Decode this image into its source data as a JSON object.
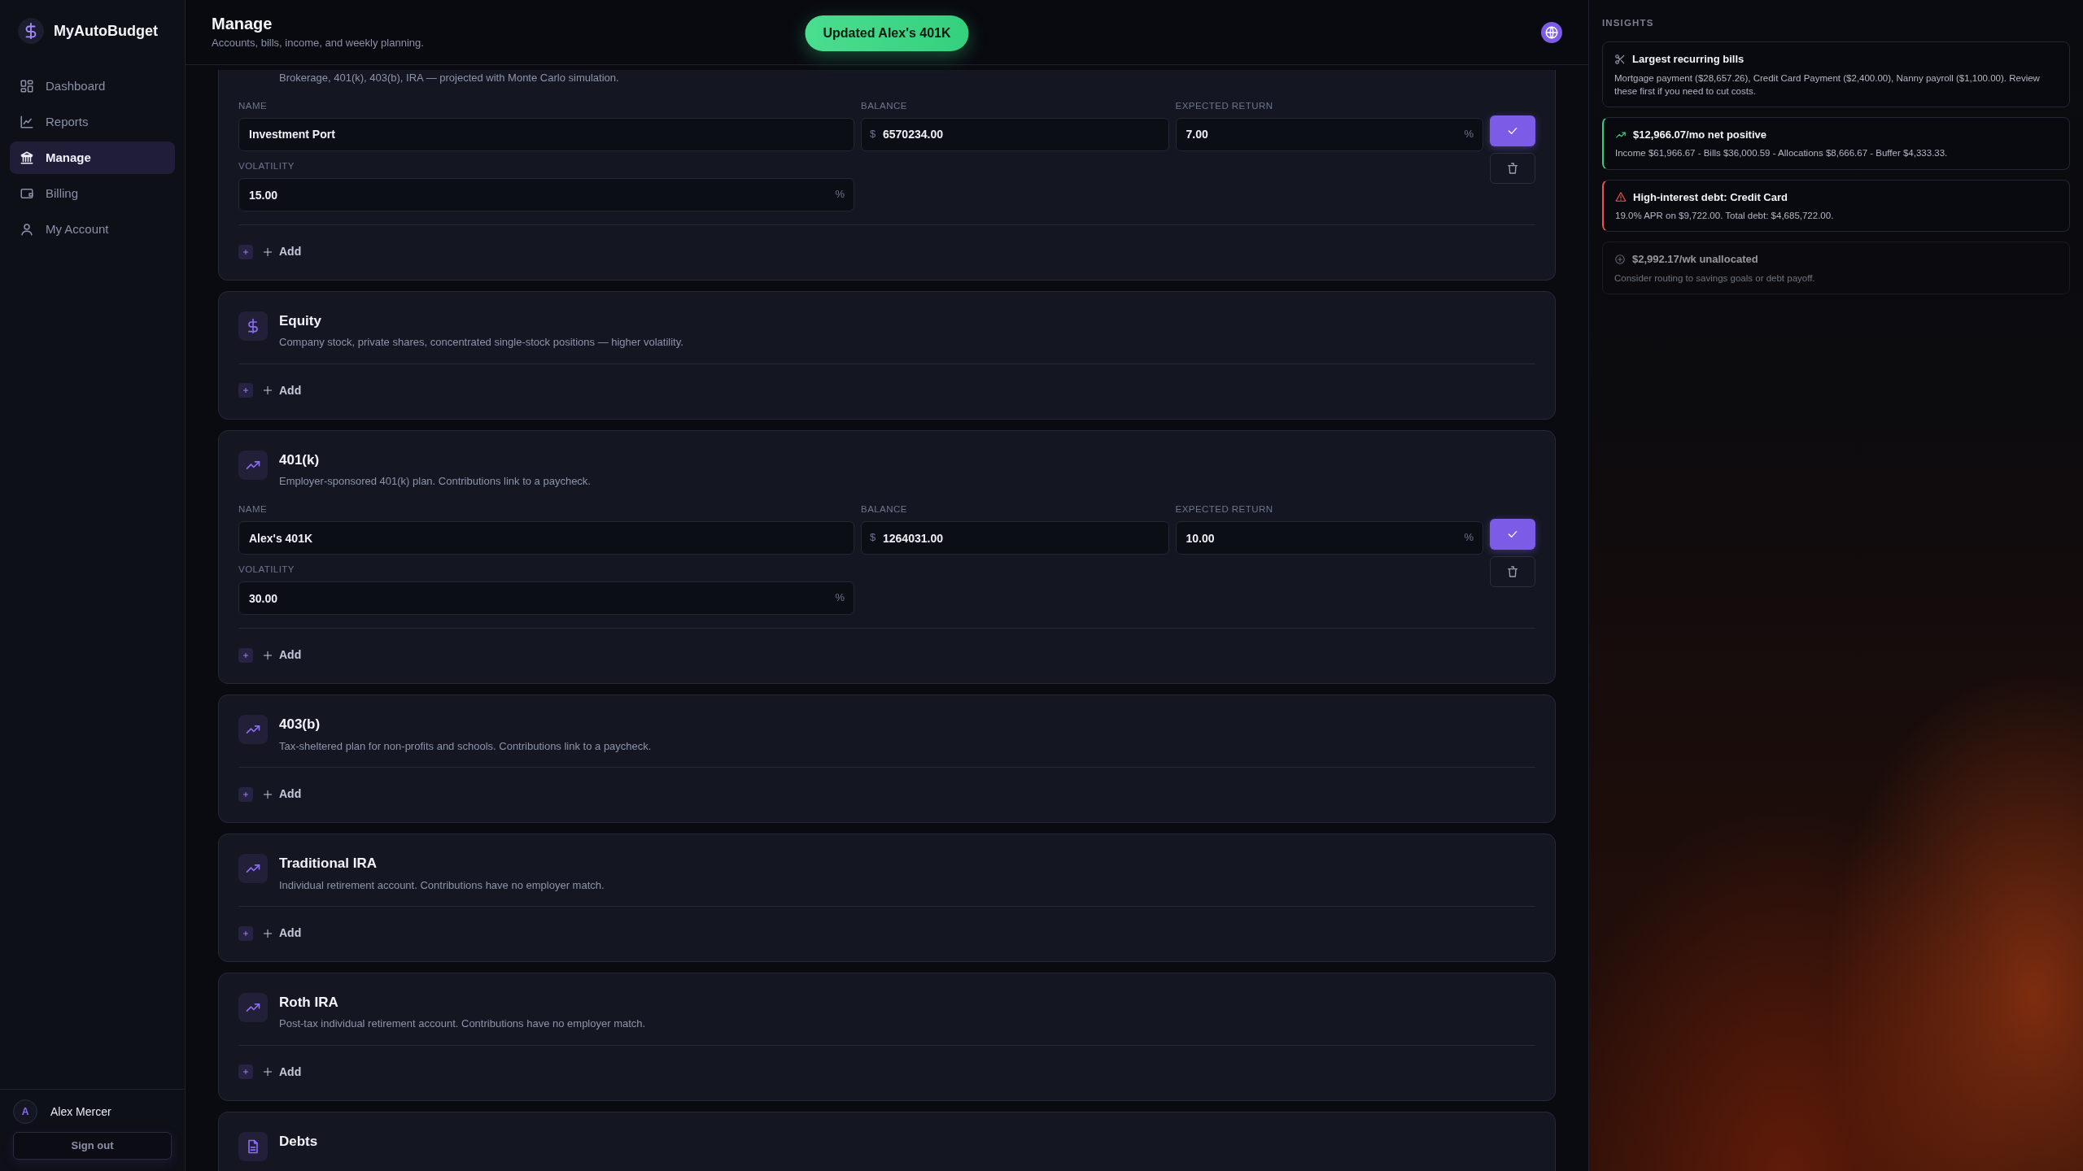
{
  "sidebar": {
    "brand": "MyAutoBudget",
    "items": [
      {
        "label": "Dashboard",
        "kind": "grid",
        "selected": false
      },
      {
        "label": "Reports",
        "kind": "chart",
        "selected": false
      },
      {
        "label": "Manage",
        "kind": "bank",
        "selected": true
      },
      {
        "label": "Billing",
        "kind": "wallet",
        "selected": false
      },
      {
        "label": "My Account",
        "kind": "user",
        "selected": false
      }
    ],
    "user": {
      "initial": "A",
      "name": "Alex Mercer"
    },
    "sign_out": "Sign out"
  },
  "header": {
    "title": "Manage",
    "subtitle": "Accounts, bills, income, and weekly planning.",
    "toast": "Updated Alex's 401K"
  },
  "sections": [
    {
      "description": "Brokerage, 401(k), 403(b), IRA — projected with Monte Carlo simulation.",
      "accounts": [
        {
          "fields": [
            {
              "label": "NAME",
              "value": "Investment Port"
            },
            {
              "label": "BALANCE",
              "prefix": "$",
              "value": "6570234.00"
            },
            {
              "label": "EXPECTED RETURN",
              "value": "7.00",
              "suffix": "%"
            },
            {
              "label": "VOLATILITY",
              "value": "15.00",
              "suffix": "%"
            }
          ]
        }
      ],
      "add": "Add"
    },
    {
      "kind": "dollar",
      "title": "Equity",
      "description": "Company stock, private shares, concentrated single-stock positions — higher volatility.",
      "add": "Add"
    },
    {
      "kind": "trend",
      "title": "401(k)",
      "description": "Employer-sponsored 401(k) plan. Contributions link to a paycheck.",
      "accounts": [
        {
          "fields": [
            {
              "label": "NAME",
              "value": "Alex's 401K"
            },
            {
              "label": "BALANCE",
              "prefix": "$",
              "value": "1264031.00"
            },
            {
              "label": "EXPECTED RETURN",
              "value": "10.00",
              "suffix": "%"
            },
            {
              "label": "VOLATILITY",
              "value": "30.00",
              "suffix": "%"
            }
          ]
        }
      ],
      "add": "Add"
    },
    {
      "kind": "trend",
      "title": "403(b)",
      "description": "Tax-sheltered plan for non-profits and schools. Contributions link to a paycheck.",
      "add": "Add"
    },
    {
      "kind": "trend",
      "title": "Traditional IRA",
      "description": "Individual retirement account. Contributions have no employer match.",
      "add": "Add"
    },
    {
      "kind": "trend",
      "title": "Roth IRA",
      "description": "Post-tax individual retirement account. Contributions have no employer match.",
      "add": "Add"
    },
    {
      "kind": "document",
      "title": "Debts"
    }
  ],
  "insights": {
    "heading": "INSIGHTS",
    "items": [
      {
        "kind": "tip",
        "faded": false,
        "title": "Largest recurring bills",
        "text": "Mortgage payment ($28,657.26), Credit Card Payment ($2,400.00), Nanny payroll ($1,100.00). Review these first if you need to cut costs."
      },
      {
        "kind": "positive",
        "faded": false,
        "title": "$12,966.07/mo net positive",
        "text": "Income $61,966.67 - Bills $36,000.59 - Allocations $8,666.67 - Buffer $4,333.33."
      },
      {
        "kind": "warning",
        "faded": false,
        "title": "High-interest debt: Credit Card",
        "text": "19.0% APR on $9,722.00. Total debt: $4,685,722.00."
      },
      {
        "kind": "info",
        "faded": true,
        "title": "$2,992.17/wk unallocated",
        "text": "Consider routing to savings goals or debt payoff."
      }
    ]
  }
}
